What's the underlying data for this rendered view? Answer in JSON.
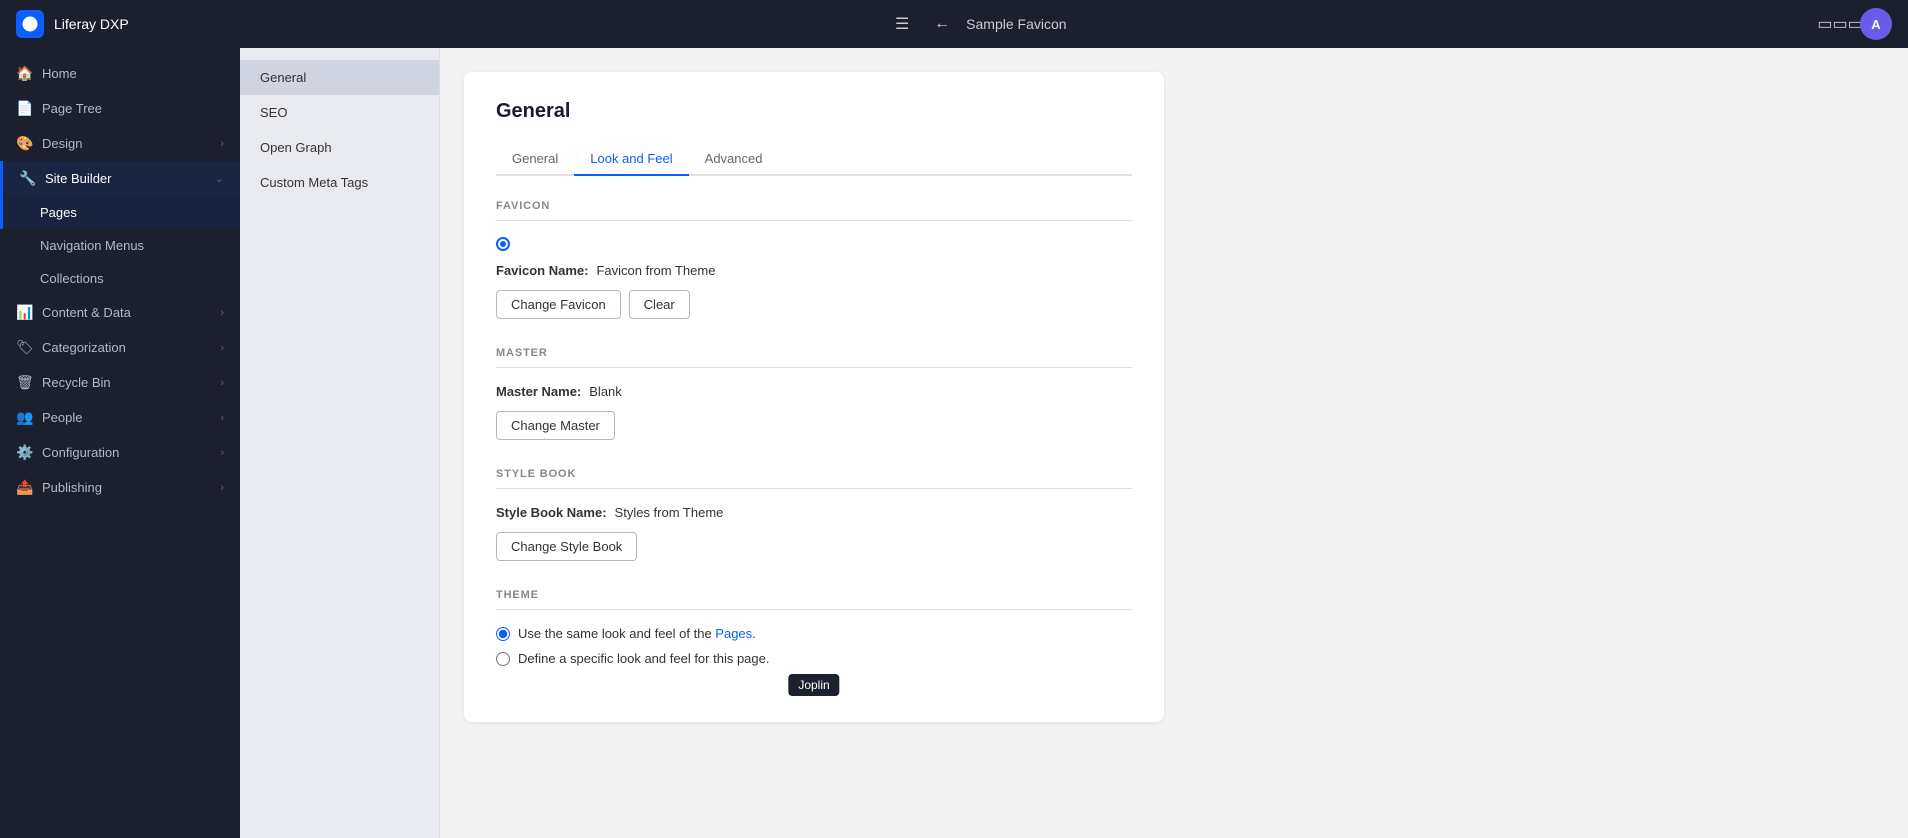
{
  "topbar": {
    "logo_alt": "Liferay DXP",
    "title": "Liferay DXP",
    "page_title": "Sample Favicon",
    "avatar_initials": "A"
  },
  "sidebar": {
    "items": [
      {
        "id": "home",
        "label": "Home",
        "icon": "🏠",
        "has_chevron": false
      },
      {
        "id": "page-tree",
        "label": "Page Tree",
        "icon": "📄",
        "has_chevron": false
      },
      {
        "id": "design",
        "label": "Design",
        "icon": "🎨",
        "has_chevron": true
      },
      {
        "id": "site-builder",
        "label": "Site Builder",
        "icon": "🔧",
        "has_chevron": true,
        "active": true
      },
      {
        "id": "pages",
        "label": "Pages",
        "icon": "",
        "is_child": true,
        "active_child": true
      },
      {
        "id": "navigation-menus",
        "label": "Navigation Menus",
        "icon": "",
        "is_child": true
      },
      {
        "id": "collections",
        "label": "Collections",
        "icon": "",
        "is_child": true
      },
      {
        "id": "content-data",
        "label": "Content & Data",
        "icon": "📊",
        "has_chevron": true
      },
      {
        "id": "categorization",
        "label": "Categorization",
        "icon": "🏷",
        "has_chevron": true
      },
      {
        "id": "recycle-bin",
        "label": "Recycle Bin",
        "icon": "🗑",
        "has_chevron": true
      },
      {
        "id": "people",
        "label": "People",
        "icon": "👥",
        "has_chevron": true
      },
      {
        "id": "configuration",
        "label": "Configuration",
        "icon": "⚙️",
        "has_chevron": true
      },
      {
        "id": "publishing",
        "label": "Publishing",
        "icon": "📤",
        "has_chevron": true
      }
    ]
  },
  "settings_nav": {
    "items": [
      {
        "id": "general",
        "label": "General",
        "active": true
      },
      {
        "id": "seo",
        "label": "SEO"
      },
      {
        "id": "open-graph",
        "label": "Open Graph"
      },
      {
        "id": "custom-meta-tags",
        "label": "Custom Meta Tags"
      }
    ]
  },
  "content": {
    "title": "General",
    "tabs": [
      {
        "id": "general",
        "label": "General"
      },
      {
        "id": "look-and-feel",
        "label": "Look and Feel",
        "active": true
      },
      {
        "id": "advanced",
        "label": "Advanced"
      }
    ],
    "favicon_section": {
      "header": "FAVICON",
      "favicon_name_label": "Favicon Name:",
      "favicon_name_value": "Favicon from Theme",
      "change_favicon_btn": "Change Favicon",
      "clear_btn": "Clear"
    },
    "master_section": {
      "header": "MASTER",
      "master_name_label": "Master Name:",
      "master_name_value": "Blank",
      "change_master_btn": "Change Master"
    },
    "style_book_section": {
      "header": "STYLE BOOK",
      "style_book_name_label": "Style Book Name:",
      "style_book_name_value": "Styles from Theme",
      "change_style_book_btn": "Change Style Book"
    },
    "theme_section": {
      "header": "THEME",
      "radio_options": [
        {
          "id": "same-look",
          "label": "Use the same look and feel of the",
          "link": "Pages",
          "link_suffix": ".",
          "selected": true
        },
        {
          "id": "define-look",
          "label": "Define a specific look and feel for this page."
        }
      ],
      "tooltip": "Joplin"
    }
  }
}
